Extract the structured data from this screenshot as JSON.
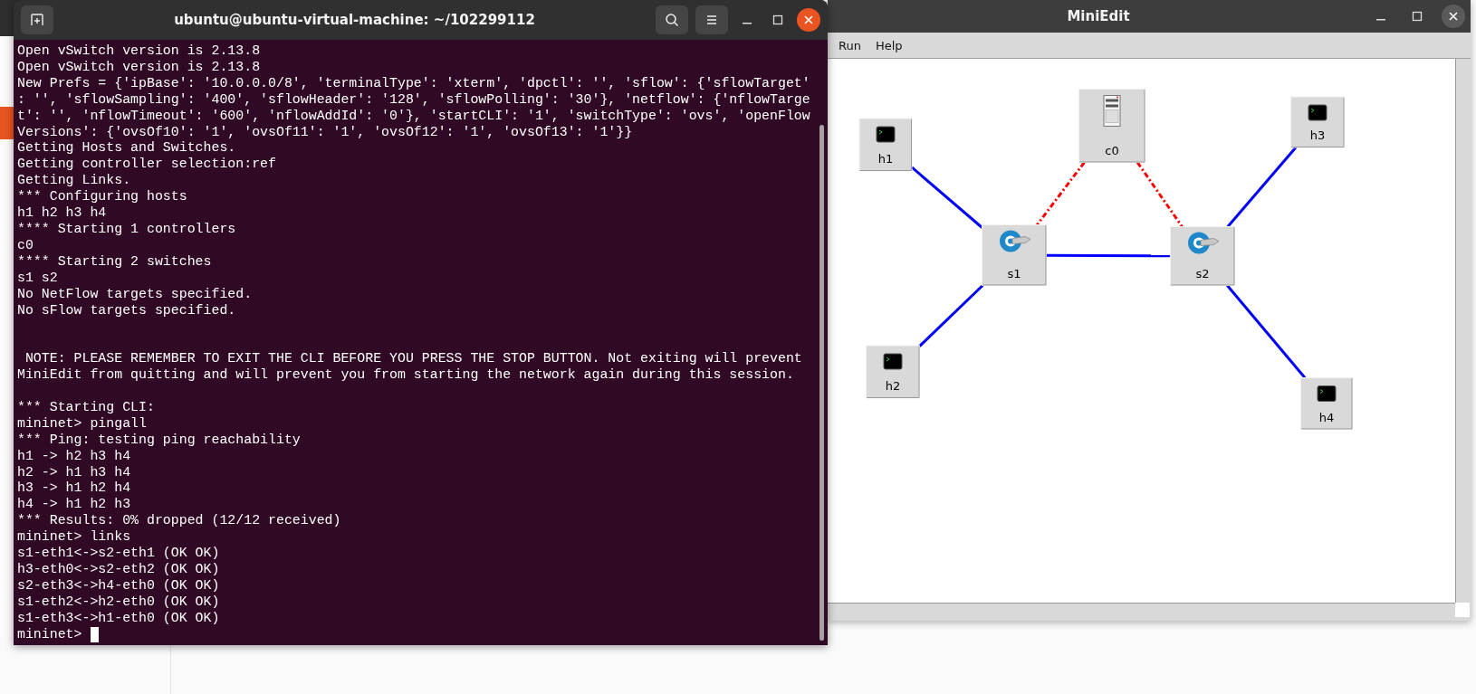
{
  "terminal": {
    "title": "ubuntu@ubuntu-virtual-machine: ~/102299112",
    "lines": [
      {
        "text": "Open vSwitch version is 2.13.8"
      },
      {
        "text": "Open vSwitch version is 2.13.8"
      },
      {
        "text": "New Prefs = {'ipBase': '10.0.0.0/8', 'terminalType': 'xterm', 'dpctl': '', 'sflow': {'sflowTarget'"
      },
      {
        "text": ": '', 'sflowSampling': '400', 'sflowHeader': '128', 'sflowPolling': '30'}, 'netflow': {'nflowTarge"
      },
      {
        "text": "t': '', 'nflowTimeout': '600', 'nflowAddId': '0'}, 'startCLI': '1', 'switchType': 'ovs', 'openFlow"
      },
      {
        "text": "Versions': {'ovsOf10': '1', 'ovsOf11': '1', 'ovsOf12': '1', 'ovsOf13': '1'}}"
      },
      {
        "text": "Getting Hosts and Switches."
      },
      {
        "text": "Getting controller selection:ref"
      },
      {
        "text": "Getting Links."
      },
      {
        "text": "*** Configuring hosts"
      },
      {
        "text": "h1 h2 h3 h4"
      },
      {
        "text": "**** Starting 1 controllers"
      },
      {
        "text": "c0"
      },
      {
        "text": "**** Starting 2 switches"
      },
      {
        "text": "s1 s2"
      },
      {
        "text": "No NetFlow targets specified."
      },
      {
        "text": "No sFlow targets specified."
      },
      {
        "kind": "blank"
      },
      {
        "kind": "blank"
      },
      {
        "text": " NOTE: PLEASE REMEMBER TO EXIT THE CLI BEFORE YOU PRESS THE STOP BUTTON. Not exiting will prevent"
      },
      {
        "text": "MiniEdit from quitting and will prevent you from starting the network again during this session."
      },
      {
        "kind": "blank"
      },
      {
        "text": "*** Starting CLI:"
      },
      {
        "text": "mininet> pingall"
      },
      {
        "text": "*** Ping: testing ping reachability"
      },
      {
        "text": "h1 -> h2 h3 h4"
      },
      {
        "text": "h2 -> h1 h3 h4"
      },
      {
        "text": "h3 -> h1 h2 h4"
      },
      {
        "text": "h4 -> h1 h2 h3"
      },
      {
        "text": "*** Results: 0% dropped (12/12 received)"
      },
      {
        "text": "mininet> links"
      },
      {
        "text": "s1-eth1<->s2-eth1 (OK OK)"
      },
      {
        "text": "h3-eth0<->s2-eth2 (OK OK)"
      },
      {
        "text": "s2-eth3<->h4-eth0 (OK OK)"
      },
      {
        "text": "s1-eth2<->h2-eth0 (OK OK)"
      },
      {
        "text": "s1-eth3<->h1-eth0 (OK OK)"
      },
      {
        "text": "mininet>"
      }
    ],
    "cursor": true
  },
  "miniedit": {
    "title": "MiniEdit",
    "menu": [
      {
        "label": "Run"
      },
      {
        "label": "Help"
      }
    ],
    "nodes": [
      {
        "kind": "host",
        "label": "h1"
      },
      {
        "kind": "controller",
        "label": "c0"
      },
      {
        "kind": "host",
        "label": "h3"
      },
      {
        "kind": "switch",
        "label": "s1"
      },
      {
        "kind": "switch",
        "label": "s2"
      },
      {
        "kind": "host",
        "label": "h2"
      },
      {
        "kind": "host",
        "label": "h4"
      }
    ],
    "links": [
      {
        "kind": "data"
      },
      {
        "kind": "data"
      },
      {
        "kind": "data"
      },
      {
        "kind": "data"
      },
      {
        "kind": "data"
      },
      {
        "kind": "control"
      },
      {
        "kind": "control"
      }
    ]
  }
}
